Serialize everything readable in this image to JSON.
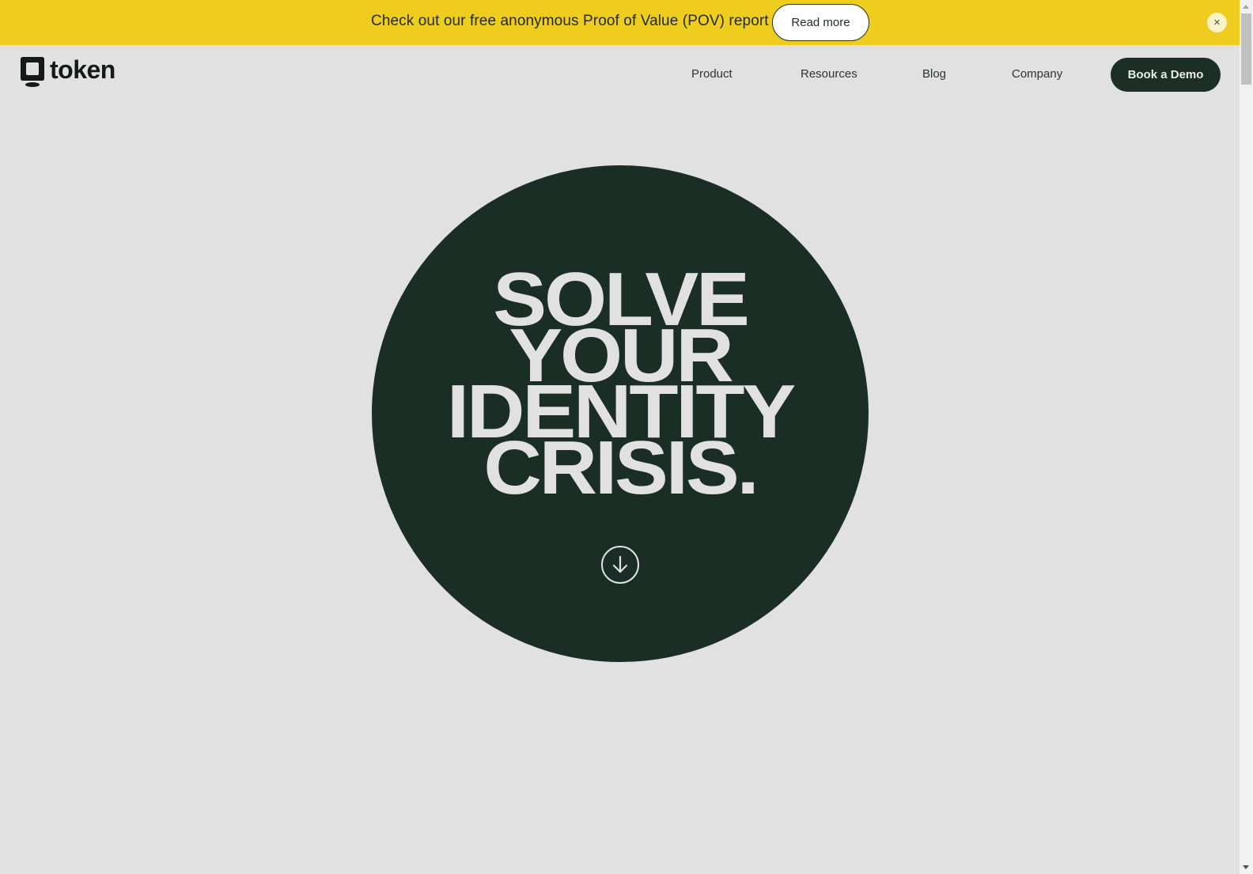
{
  "announcement": {
    "text": "Check out our free anonymous Proof of Value (POV) report",
    "button_label": "Read more",
    "close_icon": "close-icon",
    "close_glyph": "×"
  },
  "nav": {
    "logo_text": "token",
    "logo_icon": "token-logo-icon",
    "links": [
      {
        "label": "Product"
      },
      {
        "label": "Resources"
      },
      {
        "label": "Blog"
      },
      {
        "label": "Company"
      }
    ],
    "cta_label": "Book a Demo"
  },
  "hero": {
    "title_lines": [
      "SOLVE",
      "YOUR",
      "IDENTITY",
      "CRISIS."
    ],
    "scroll_icon": "arrow-down-circle-icon"
  },
  "colors": {
    "announcement_bg": "#efcd1f",
    "page_bg": "#e1e1e1",
    "brand_dark_green": "#1b2e26",
    "hero_text": "#e1e1e1"
  }
}
